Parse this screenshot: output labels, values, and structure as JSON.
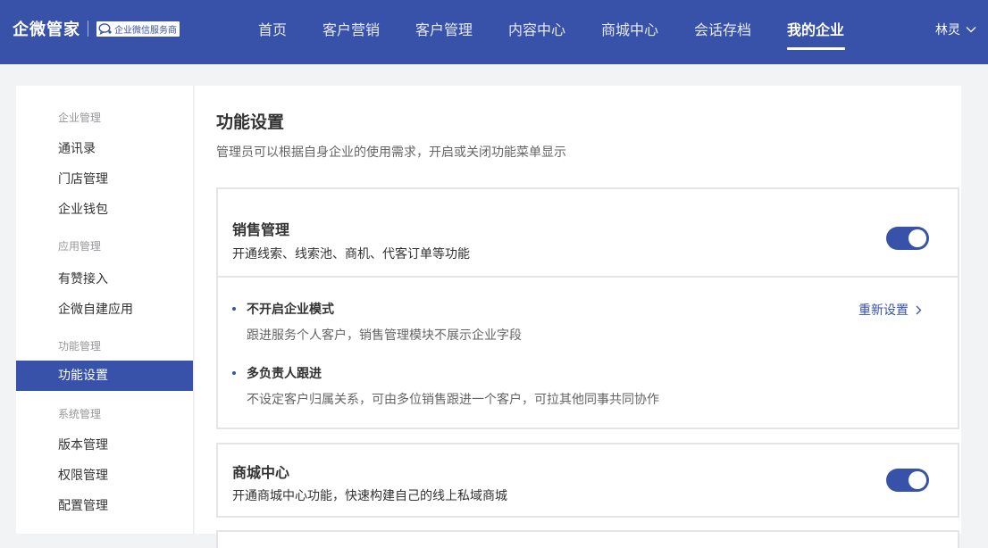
{
  "brand": {
    "name": "企微管家",
    "badge_text": "企业微信服务商"
  },
  "nav": {
    "items": [
      {
        "label": "首页"
      },
      {
        "label": "客户营销"
      },
      {
        "label": "客户管理"
      },
      {
        "label": "内容中心"
      },
      {
        "label": "商城中心"
      },
      {
        "label": "会话存档"
      },
      {
        "label": "我的企业"
      }
    ],
    "active": "我的企业",
    "user": "林灵"
  },
  "sidebar": {
    "groups": [
      {
        "title": "企业管理",
        "items": [
          "通讯录",
          "门店管理",
          "企业钱包"
        ]
      },
      {
        "title": "应用管理",
        "items": [
          "有赞接入",
          "企微自建应用"
        ]
      },
      {
        "title": "功能管理",
        "items": [
          "功能设置"
        ]
      },
      {
        "title": "系统管理",
        "items": [
          "版本管理",
          "权限管理",
          "配置管理"
        ]
      }
    ],
    "active": "功能设置"
  },
  "main": {
    "title": "功能设置",
    "description": "管理员可以根据自身企业的使用需求，开启或关闭功能菜单显示",
    "cards": [
      {
        "title": "销售管理",
        "description": "开通线索、线索池、商机、代客订单等功能",
        "enabled": true,
        "reset_label": "重新设置",
        "options": [
          {
            "title": "不开启企业模式",
            "description": "跟进服务个人客户，销售管理模块不展示企业字段"
          },
          {
            "title": "多负责人跟进",
            "description": "不设定客户归属关系，可由多位销售跟进一个客户，可拉其他同事共同协作"
          }
        ]
      },
      {
        "title": "商城中心",
        "description": "开通商城中心功能，快速构建自己的线上私域商城",
        "enabled": true
      }
    ]
  },
  "colors": {
    "primary": "#3752a8",
    "background": "#f2f3f5",
    "border": "#e3e5e9"
  },
  "icons": [
    "chat-bubble-icon",
    "chevron-down-icon",
    "chevron-right-icon"
  ]
}
